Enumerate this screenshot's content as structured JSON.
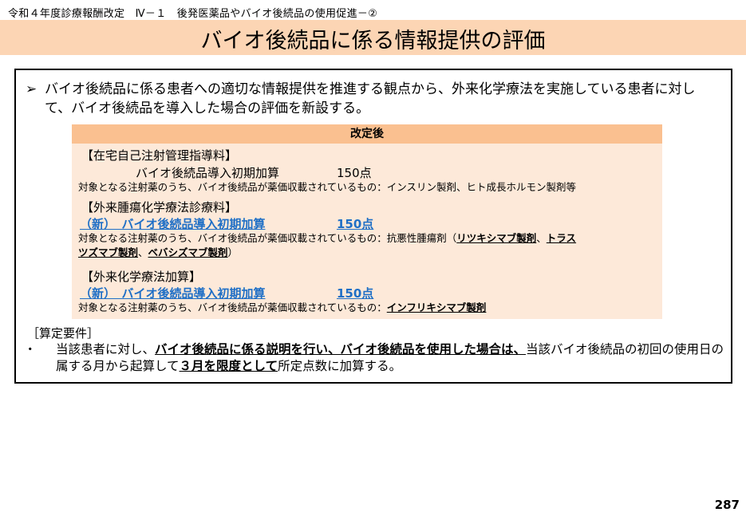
{
  "header": {
    "text": "令和４年度診療報酬改定　Ⅳ－１　後発医薬品やバイオ後続品の使用促進－②"
  },
  "title": "バイオ後続品に係る情報提供の評価",
  "bullet": {
    "mark": "➢",
    "text": "バイオ後続品に係る患者への適切な情報提供を推進する観点から、外来化学療法を実施している患者に対して、バイオ後続品を導入した場合の評価を新設する。"
  },
  "panel": {
    "header": "改定後",
    "sections": [
      {
        "title": "【在宅自己注射管理指導料】",
        "item_name": "バイオ後続品導入初期加算",
        "item_points": "150点",
        "note_prefix": "対象となる注射薬のうち、バイオ後続品が薬価収載されているもの：インスリン製剤、ヒト成長ホルモン製剤等"
      },
      {
        "title": "【外来腫瘍化学療法診療料】",
        "item_new": "（新）　バイオ後続品導入初期加算",
        "item_points": "150点",
        "note_prefix": "対象となる注射薬のうち、バイオ後続品が薬価収載されているもの：抗悪性腫瘍剤（",
        "note_u1": "リツキシマブ製剤",
        "note_sep1": "、",
        "note_u2a": "トラス",
        "note_u2b": "ツズマブ製剤",
        "note_sep2": "、",
        "note_u3": "ベバシズマブ製剤",
        "note_end": "）"
      },
      {
        "title": "【外来化学療法加算】",
        "item_new": "（新）　バイオ後続品導入初期加算",
        "item_points": "150点",
        "note_prefix": "対象となる注射薬のうち、バイオ後続品が薬価収載されているもの：",
        "note_u1": "インフリキシマブ製剤"
      }
    ]
  },
  "requirements": {
    "title": "［算定要件］",
    "dot": "・",
    "t1": "当該患者に対し、",
    "u1": "バイオ後続品に係る説明を行い、バイオ後続品を使用した場合は、",
    "t2": "当該バイオ後続品の初回の使用日の属する月から起算して",
    "u2": "３月を限度として",
    "t3": "所定点数に加算する。"
  },
  "page_number": "287"
}
